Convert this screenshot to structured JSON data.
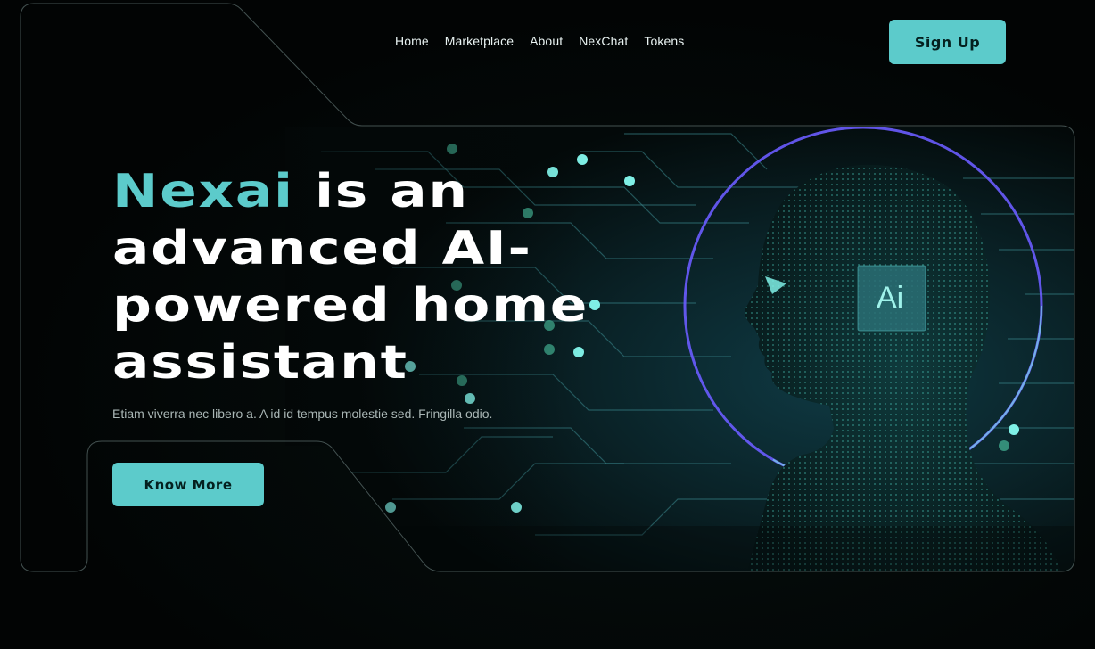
{
  "nav": {
    "items": [
      "Home",
      "Marketplace",
      "About",
      "NexChat",
      "Tokens"
    ]
  },
  "header": {
    "signup_label": "Sign Up"
  },
  "hero": {
    "headline_accent": "Nexai",
    "headline_rest": " is an advanced AI-powered home assistant",
    "subtitle": "Etiam viverra nec libero a. A id id tempus molestie sed. Fringilla odio.",
    "cta_label": "Know More",
    "chip_label": "Ai"
  },
  "colors": {
    "accent": "#5ccbcb",
    "background": "#030707",
    "ring": "#6a5cff"
  }
}
